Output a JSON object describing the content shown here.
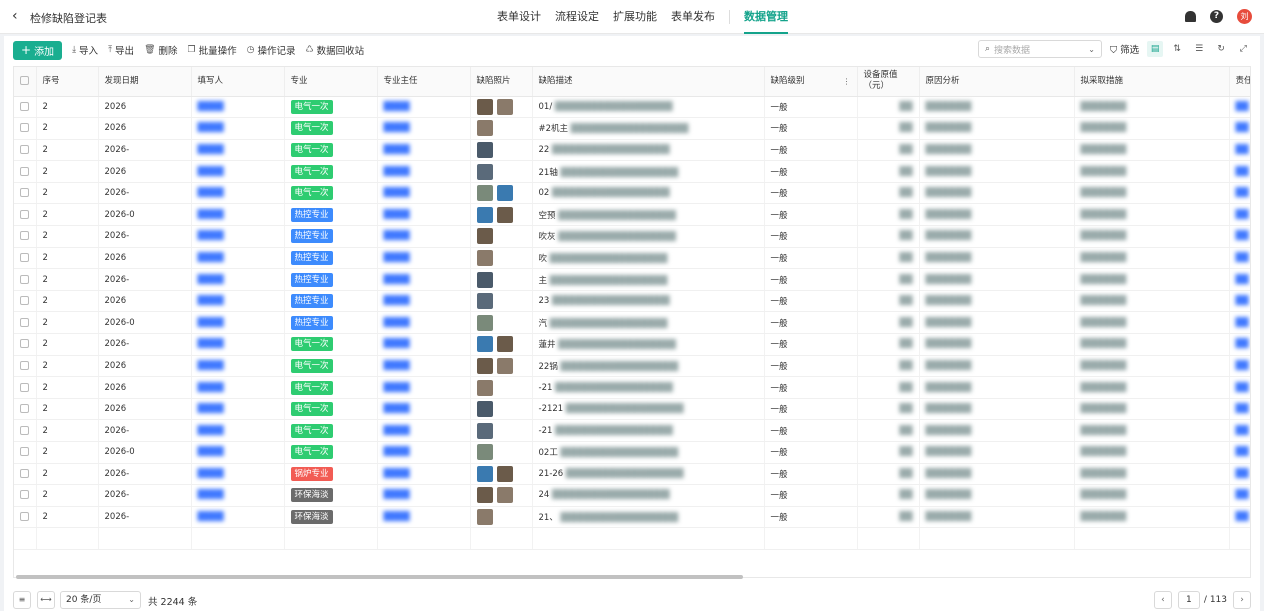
{
  "header": {
    "back_icon": "chevron-left-icon",
    "title": "检修缺陷登记表",
    "tabs": [
      {
        "label": "表单设计",
        "active": false
      },
      {
        "label": "流程设定",
        "active": false
      },
      {
        "label": "扩展功能",
        "active": false
      },
      {
        "label": "表单发布",
        "active": false
      },
      {
        "label": "数据管理",
        "active": true
      }
    ],
    "avatar_text": "刘",
    "icons": [
      "bell-icon",
      "help-icon"
    ],
    "accent_color": "#14a38b"
  },
  "toolbar": {
    "add_label": "添加",
    "import_label": "导入",
    "export_label": "导出",
    "delete_label": "删除",
    "batch_label": "批量操作",
    "log_label": "操作记录",
    "recycle_label": "数据回收站",
    "search_placeholder": "搜索数据",
    "filter_label": "筛选"
  },
  "table": {
    "columns": [
      "序号",
      "发现日期",
      "填写人",
      "专业",
      "专业主任",
      "缺陷照片",
      "缺陷描述",
      "缺陷级别",
      "设备原值（元）",
      "原因分析",
      "拟采取措施",
      "责任"
    ],
    "rows": [
      {
        "seq": "2",
        "date": "2026",
        "spec": "电气一次",
        "spec_color": "#2ecc71",
        "photos": 2,
        "desc": "01/",
        "level": "一般"
      },
      {
        "seq": "2",
        "date": "2026",
        "spec": "电气一次",
        "spec_color": "#2ecc71",
        "photos": 1,
        "desc": "#2机主",
        "level": "一般"
      },
      {
        "seq": "2",
        "date": "2026-",
        "spec": "电气一次",
        "spec_color": "#2ecc71",
        "photos": 1,
        "desc": "22",
        "level": "一般"
      },
      {
        "seq": "2",
        "date": "2026",
        "spec": "电气一次",
        "spec_color": "#2ecc71",
        "photos": 1,
        "desc": "21轴",
        "level": "一般"
      },
      {
        "seq": "2",
        "date": "2026-",
        "spec": "电气一次",
        "spec_color": "#2ecc71",
        "photos": 2,
        "desc": "02",
        "level": "一般"
      },
      {
        "seq": "2",
        "date": "2026-0",
        "spec": "热控专业",
        "spec_color": "#3d8bfd",
        "photos": 2,
        "desc": "空预",
        "level": "一般"
      },
      {
        "seq": "2",
        "date": "2026-",
        "spec": "热控专业",
        "spec_color": "#3d8bfd",
        "photos": 1,
        "desc": "吹灰",
        "level": "一般"
      },
      {
        "seq": "2",
        "date": "2026",
        "spec": "热控专业",
        "spec_color": "#3d8bfd",
        "photos": 1,
        "desc": "吹",
        "level": "一般"
      },
      {
        "seq": "2",
        "date": "2026-",
        "spec": "热控专业",
        "spec_color": "#3d8bfd",
        "photos": 1,
        "desc": "主",
        "level": "一般"
      },
      {
        "seq": "2",
        "date": "2026",
        "spec": "热控专业",
        "spec_color": "#3d8bfd",
        "photos": 1,
        "desc": "23",
        "level": "一般"
      },
      {
        "seq": "2",
        "date": "2026-0",
        "spec": "热控专业",
        "spec_color": "#3d8bfd",
        "photos": 1,
        "desc": "汽",
        "level": "一般"
      },
      {
        "seq": "2",
        "date": "2026-",
        "spec": "电气一次",
        "spec_color": "#2ecc71",
        "photos": 2,
        "desc": "蓮井",
        "level": "一般"
      },
      {
        "seq": "2",
        "date": "2026",
        "spec": "电气一次",
        "spec_color": "#2ecc71",
        "photos": 2,
        "desc": "22锅",
        "level": "一般"
      },
      {
        "seq": "2",
        "date": "2026",
        "spec": "电气一次",
        "spec_color": "#2ecc71",
        "photos": 1,
        "desc": "-21",
        "level": "一般"
      },
      {
        "seq": "2",
        "date": "2026",
        "spec": "电气一次",
        "spec_color": "#2ecc71",
        "photos": 1,
        "desc": "-2121",
        "level": "一般"
      },
      {
        "seq": "2",
        "date": "2026-",
        "spec": "电气一次",
        "spec_color": "#2ecc71",
        "photos": 1,
        "desc": "-21",
        "level": "一般"
      },
      {
        "seq": "2",
        "date": "2026-0",
        "spec": "电气一次",
        "spec_color": "#2ecc71",
        "photos": 1,
        "desc": "02工",
        "level": "一般"
      },
      {
        "seq": "2",
        "date": "2026-",
        "spec": "锅炉专业",
        "spec_color": "#f25c54",
        "photos": 2,
        "desc": "21-26",
        "level": "一般"
      },
      {
        "seq": "2",
        "date": "2026-",
        "spec": "环保海淡",
        "spec_color": "#6b6b6b",
        "photos": 2,
        "desc": "24",
        "level": "一般"
      },
      {
        "seq": "2",
        "date": "2026-",
        "spec": "环保海淡",
        "spec_color": "#6b6b6b",
        "photos": 1,
        "desc": "21、",
        "level": "一般"
      }
    ]
  },
  "footer": {
    "page_size": "20 条/页",
    "total": "共 2244 条",
    "current_page": "1",
    "total_pages": "/ 113"
  }
}
